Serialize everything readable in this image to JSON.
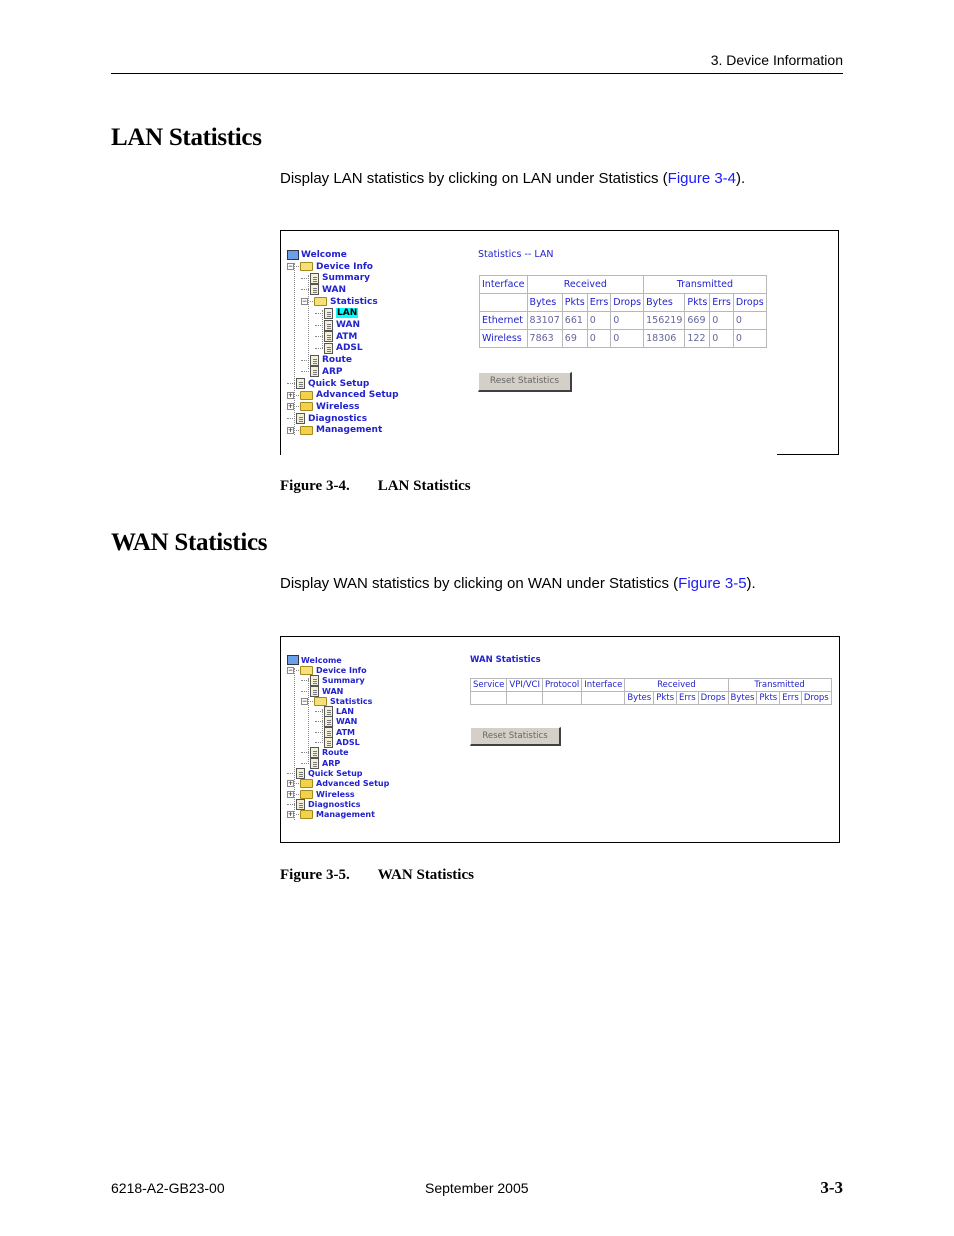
{
  "header": {
    "running_head": "3. Device Information"
  },
  "sections": [
    {
      "heading": "LAN Statistics",
      "intro_prefix": "Display LAN statistics by clicking on LAN under Statistics (",
      "intro_link": "Figure 3-4",
      "intro_suffix": ").",
      "caption_num": "Figure 3-4.",
      "caption_title": "LAN Statistics"
    },
    {
      "heading": "WAN Statistics",
      "intro_prefix": "Display WAN statistics by clicking on WAN under Statistics (",
      "intro_link": "Figure 3-5",
      "intro_suffix": ").",
      "caption_num": "Figure 3-5.",
      "caption_title": "WAN Statistics"
    }
  ],
  "tree": {
    "items": [
      {
        "label": "Welcome",
        "icon": "computer-icon",
        "level": 0
      },
      {
        "label": "Device Info",
        "icon": "folder-open-icon",
        "level": 0,
        "toggle": "minus"
      },
      {
        "label": "Summary",
        "icon": "document-icon",
        "level": 1
      },
      {
        "label": "WAN",
        "icon": "document-icon",
        "level": 1
      },
      {
        "label": "Statistics",
        "icon": "folder-open-icon",
        "level": 1,
        "toggle": "minus"
      },
      {
        "label": "LAN",
        "icon": "document-icon",
        "level": 2
      },
      {
        "label": "WAN",
        "icon": "document-icon",
        "level": 2
      },
      {
        "label": "ATM",
        "icon": "document-icon",
        "level": 2
      },
      {
        "label": "ADSL",
        "icon": "document-icon",
        "level": 2
      },
      {
        "label": "Route",
        "icon": "document-icon",
        "level": 1
      },
      {
        "label": "ARP",
        "icon": "document-icon",
        "level": 1
      },
      {
        "label": "Quick Setup",
        "icon": "document-icon",
        "level": 0
      },
      {
        "label": "Advanced Setup",
        "icon": "folder-icon",
        "level": 0,
        "toggle": "plus"
      },
      {
        "label": "Wireless",
        "icon": "folder-icon",
        "level": 0,
        "toggle": "plus"
      },
      {
        "label": "Diagnostics",
        "icon": "document-icon",
        "level": 0
      },
      {
        "label": "Management",
        "icon": "folder-icon",
        "level": 0,
        "toggle": "plus"
      }
    ],
    "lan_selected_index": 5
  },
  "lan_page": {
    "title": "Statistics -- LAN",
    "headers": {
      "interface": "Interface",
      "received": "Received",
      "transmitted": "Transmitted"
    },
    "subheaders": [
      "Bytes",
      "Pkts",
      "Errs",
      "Drops",
      "Bytes",
      "Pkts",
      "Errs",
      "Drops"
    ],
    "rows": [
      {
        "interface": "Ethernet",
        "values": [
          "83107",
          "661",
          "0",
          "0",
          "156219",
          "669",
          "0",
          "0"
        ]
      },
      {
        "interface": "Wireless",
        "values": [
          "7863",
          "69",
          "0",
          "0",
          "18306",
          "122",
          "0",
          "0"
        ]
      }
    ],
    "reset_button": "Reset Statistics"
  },
  "wan_page": {
    "title": "WAN Statistics",
    "headers": {
      "service": "Service",
      "vpi_vci": "VPI/VCI",
      "protocol": "Protocol",
      "interface": "Interface",
      "received": "Received",
      "transmitted": "Transmitted"
    },
    "subheaders": [
      "Bytes",
      "Pkts",
      "Errs",
      "Drops",
      "Bytes",
      "Pkts",
      "Errs",
      "Drops"
    ],
    "reset_button": "Reset Statistics"
  },
  "footer": {
    "doc_number": "6218-A2-GB23-00",
    "date": "September 2005",
    "page": "3-3"
  }
}
